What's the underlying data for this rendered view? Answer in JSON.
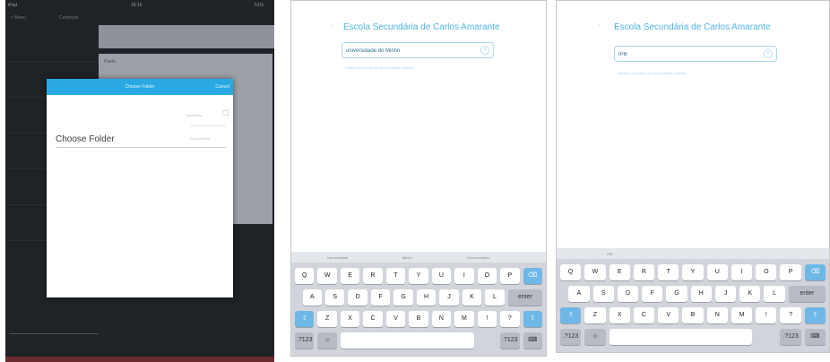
{
  "panel1": {
    "status_left": "iPad",
    "status_time": "18:16",
    "status_battery": "51%",
    "nav_back": "< Menu",
    "nav_section": "Conteúdo",
    "card_label": "Pasta",
    "modal": {
      "title": "Choose Folder",
      "cancel": "Cancel",
      "faint_label_1": "Nenhuma",
      "faint_label_2": "Documentos",
      "field_label": "Choose Folder"
    },
    "colors": {
      "modal_header": "#2aa8e2",
      "background": "#1f2226"
    }
  },
  "panel2": {
    "school": "Escola Secundária de Carlos Amarante",
    "input_value": "universidade do Minho",
    "hint": "Please hold while we find available classes",
    "suggestions": [
      "Universidade",
      "Minho",
      "Universidades"
    ]
  },
  "panel3": {
    "school": "Escola Secundária de Carlos Amarante",
    "input_value": "IPB",
    "hint": "Please hold while we find available classes",
    "suggestions": [
      "IPB"
    ]
  },
  "keyboard": {
    "row1": [
      "Q",
      "W",
      "E",
      "R",
      "T",
      "Y",
      "U",
      "I",
      "O",
      "P"
    ],
    "row2": [
      "A",
      "S",
      "D",
      "F",
      "G",
      "H",
      "J",
      "K",
      "L"
    ],
    "row3": [
      "Z",
      "X",
      "C",
      "V",
      "B",
      "N",
      "M",
      "!",
      "?"
    ],
    "enter": "enter",
    "numbers": ".?123",
    "shift_icon": "shift-icon",
    "delete_icon": "delete-icon",
    "globe_icon": "emoji-icon",
    "hide_icon": "keyboard-hide-icon"
  },
  "colors": {
    "accent": "#4fb3e2",
    "keyboard_bg": "#d1d5db"
  }
}
